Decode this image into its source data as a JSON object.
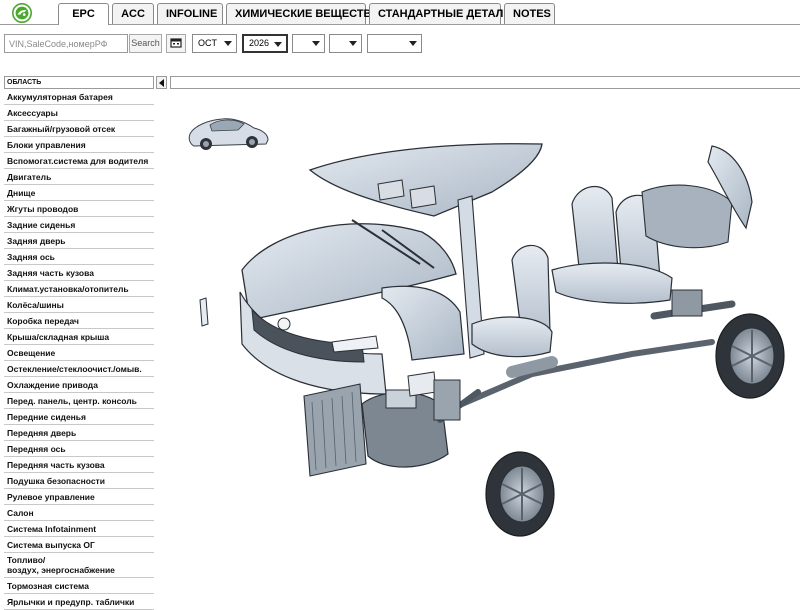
{
  "tabs": [
    {
      "label": "EPC",
      "active": true
    },
    {
      "label": "ACC",
      "active": false
    },
    {
      "label": "INFOLINE",
      "active": false
    },
    {
      "label": "ХИМИЧЕСКИЕ ВЕЩЕСТВА",
      "active": false
    },
    {
      "label": "СТАНДАРТНЫЕ ДЕТАЛИ",
      "active": false
    },
    {
      "label": "NOTES",
      "active": false
    }
  ],
  "toolbar": {
    "vin_placeholder": "VIN,SaleCode,номерРФ",
    "search_label": "Search",
    "calendar_icon": "calendar-icon",
    "month_value": "OCT",
    "year_value": "2026",
    "select3_value": "",
    "select4_value": "",
    "select5_value": ""
  },
  "panel": {
    "header": "ОБЛАСТЬ",
    "items": [
      "Аккумуляторная батарея",
      "Аксессуары",
      "Багажный/грузовой отсек",
      "Блоки управления",
      "Вспомогат.система для водителя",
      "Двигатель",
      "Днище",
      "Жгуты проводов",
      "Задние сиденья",
      "Задняя дверь",
      "Задняя ось",
      "Задняя часть кузова",
      "Климат.установка/отопитель",
      "Колёса/шины",
      "Коробка передач",
      "Крыша/складная крыша",
      "Освещение",
      "Остекление/стеклоочист./омыв.",
      "Охлаждение привода",
      "Перед. панель, центр. консоль",
      "Передние сиденья",
      "Передняя дверь",
      "Передняя ось",
      "Передняя часть кузова",
      "Подушка безопасности",
      "Рулевое управление",
      "Салон",
      "Система Infotainment",
      "Система выпуска ОГ",
      "Топливо/\nвоздух, энергоснабжение",
      "Тормозная система",
      "Ярлычки и предупр. таблички"
    ]
  },
  "colors": {
    "body_blue": "#c7d2de",
    "line": "#2b2f36",
    "logo_green": "#4ba82e"
  }
}
